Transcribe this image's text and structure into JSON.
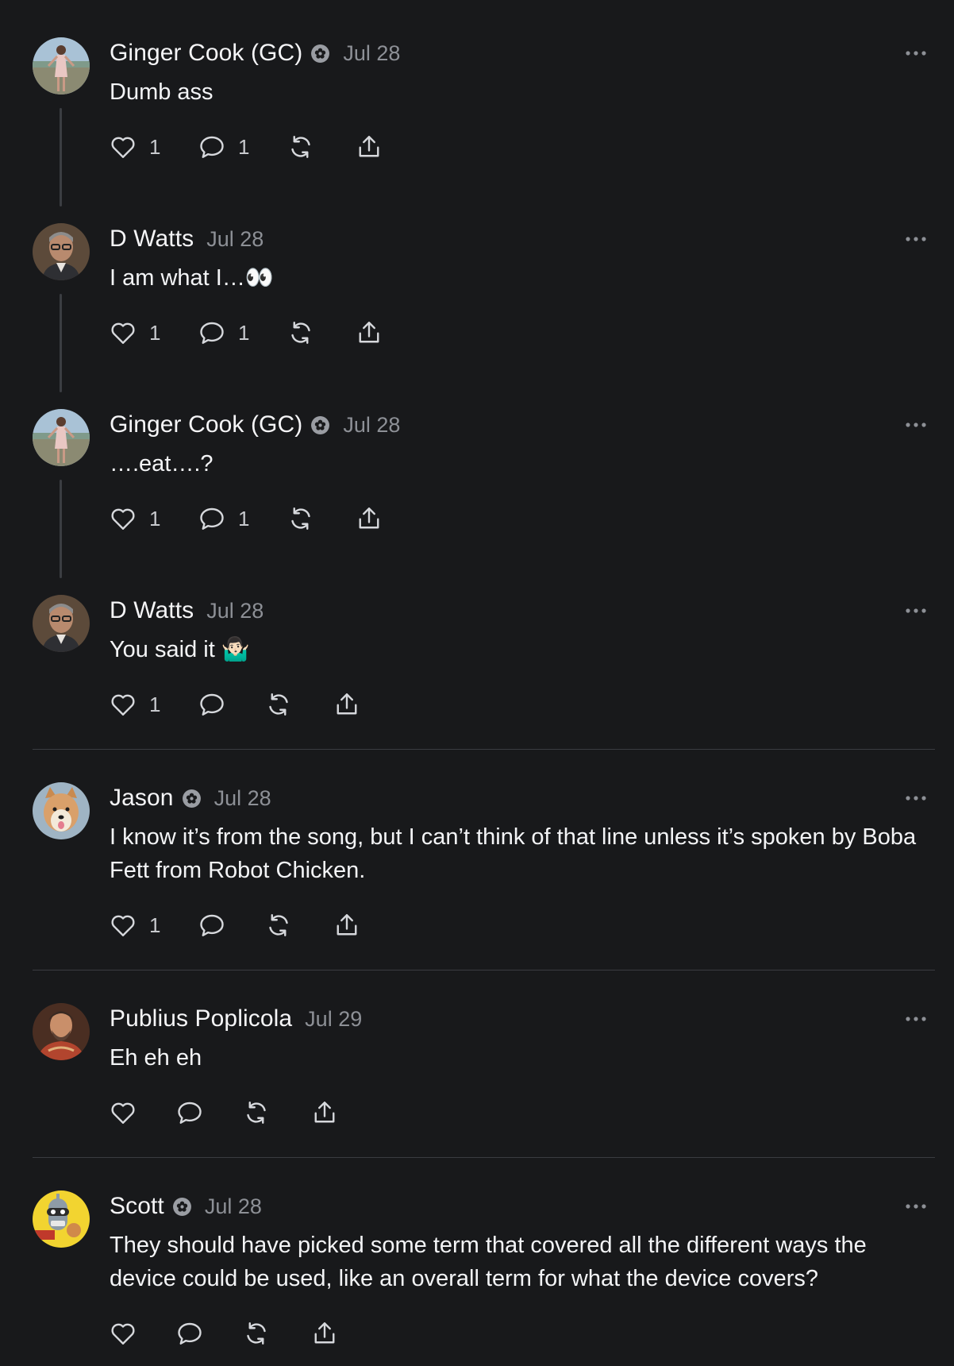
{
  "colors": {
    "background": "#18191b",
    "text": "#f3f4f6",
    "muted": "#8d9096",
    "thread_line": "#3b3d42",
    "divider": "#3a3c41"
  },
  "posts": [
    {
      "author": "Ginger Cook (GC)",
      "verified_badge": true,
      "date": "Jul 28",
      "text": "Dumb ass",
      "likes": "1",
      "replies": "1",
      "avatar": "woman-standing-avatar"
    },
    {
      "author": "D Watts",
      "verified_badge": false,
      "date": "Jul 28",
      "text": "I am what I…👀",
      "likes": "1",
      "replies": "1",
      "avatar": "man-glasses-avatar"
    },
    {
      "author": "Ginger Cook (GC)",
      "verified_badge": true,
      "date": "Jul 28",
      "text": "….eat….?",
      "likes": "1",
      "replies": "1",
      "avatar": "woman-standing-avatar"
    },
    {
      "author": "D Watts",
      "verified_badge": false,
      "date": "Jul 28",
      "text": "You said it 🤷🏻‍♂️",
      "likes": "1",
      "replies": "",
      "avatar": "man-glasses-avatar"
    },
    {
      "author": "Jason",
      "verified_badge": true,
      "date": "Jul 28",
      "text": "I know it’s from the song, but I can’t think of that line unless it’s spoken by Boba Fett from Robot Chicken.",
      "likes": "1",
      "replies": "",
      "avatar": "shiba-dog-avatar"
    },
    {
      "author": "Publius Poplicola",
      "verified_badge": false,
      "date": "Jul 29",
      "text": "Eh eh eh",
      "likes": "",
      "replies": "",
      "avatar": "roman-statue-avatar"
    },
    {
      "author": "Scott",
      "verified_badge": true,
      "date": "Jul 28",
      "text": "They should have picked some term that covered all the different ways the device could be used, like an overall term for what the device covers?",
      "likes": "",
      "replies": "",
      "avatar": "robot-cartoon-avatar"
    }
  ],
  "icons": {
    "like": "heart-icon",
    "reply": "comment-bubble-icon",
    "repost": "repost-arrows-icon",
    "share": "share-upload-icon",
    "more": "more-dots-icon",
    "badge": "verified-flower-icon"
  }
}
